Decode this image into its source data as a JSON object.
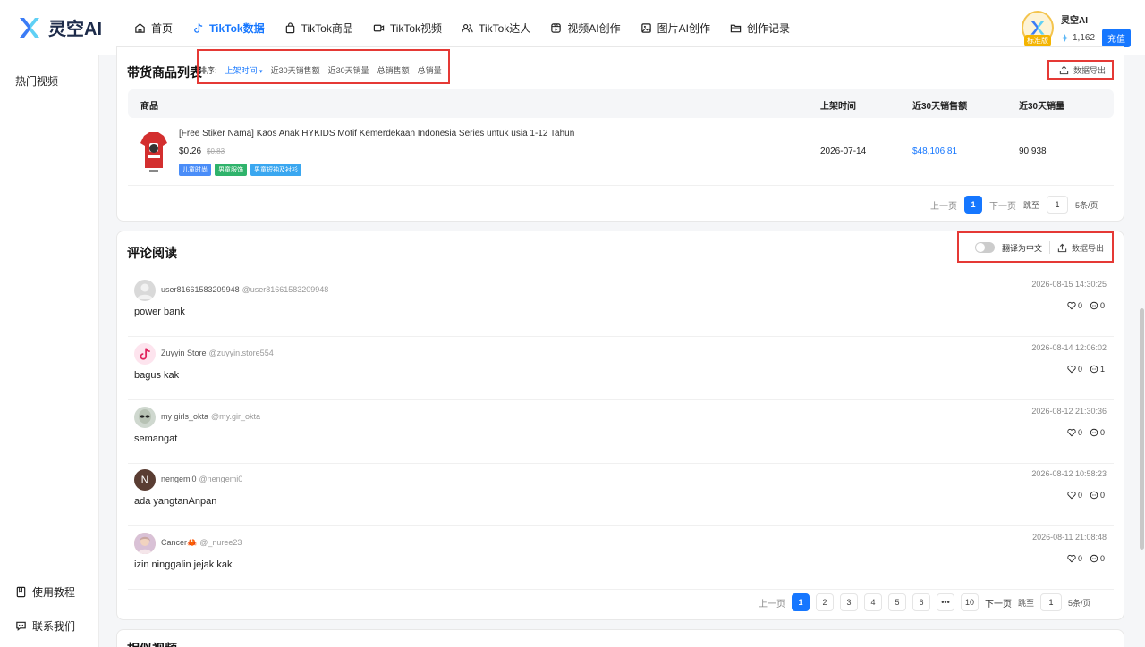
{
  "header": {
    "logo_text": "灵空AI",
    "nav": [
      {
        "label": "首页",
        "icon": "home-icon",
        "active": false
      },
      {
        "label": "TikTok数据",
        "icon": "tiktok-icon",
        "active": true
      },
      {
        "label": "TikTok商品",
        "icon": "bag-icon",
        "active": false
      },
      {
        "label": "TikTok视频",
        "icon": "video-icon",
        "active": false
      },
      {
        "label": "TikTok达人",
        "icon": "users-icon",
        "active": false
      },
      {
        "label": "视频AI创作",
        "icon": "film-icon",
        "active": false
      },
      {
        "label": "图片AI创作",
        "icon": "image-icon",
        "active": false
      },
      {
        "label": "创作记录",
        "icon": "folder-icon",
        "active": false
      }
    ],
    "user": {
      "name": "灵空AI",
      "badge": "标准版",
      "points": "1,162",
      "recharge": "充值"
    }
  },
  "sidebar": {
    "top_item": "热门视频",
    "bottom_items": [
      {
        "label": "使用教程",
        "icon": "book-icon"
      },
      {
        "label": "联系我们",
        "icon": "chat-icon"
      }
    ]
  },
  "products_card": {
    "title": "带货商品列表",
    "sort_label": "排序:",
    "sort_options": [
      "上架时间",
      "近30天销售额",
      "近30天销量",
      "总销售额",
      "总销量"
    ],
    "export_label": "数据导出",
    "columns": [
      "商品",
      "上架时间",
      "近30天销售额",
      "近30天销量"
    ],
    "rows": [
      {
        "name": "[Free Stiker Nama] Kaos Anak HYKIDS Motif Kemerdekaan Indonesia Series untuk usia 1-12 Tahun",
        "price": "$0.26",
        "old_price": "$0.83",
        "tags": [
          "儿童时尚",
          "男童服饰",
          "男童短袖及衬衫"
        ],
        "listed": "2026-07-14",
        "sales_30d": "$48,106.81",
        "volume_30d": "90,938"
      }
    ],
    "pager": {
      "prev": "上一页",
      "next": "下一页",
      "current": "1",
      "jump_label": "跳至",
      "jump_value": "1",
      "page_size": "5条/页"
    }
  },
  "comments_card": {
    "title": "评论阅读",
    "translate_label": "翻译为中文",
    "export_label": "数据导出",
    "comments": [
      {
        "user": "user81661583209948",
        "handle": "@user81661583209948",
        "text": "power bank",
        "time": "2026-08-15 14:30:25",
        "likes": "0",
        "replies": "0"
      },
      {
        "user": "Zuyyin Store",
        "handle": "@zuyyin.store554",
        "text": "bagus kak",
        "time": "2026-08-14 12:06:02",
        "likes": "0",
        "replies": "1"
      },
      {
        "user": "my girls_okta",
        "handle": "@my.gir_okta",
        "text": "semangat",
        "time": "2026-08-12 21:30:36",
        "likes": "0",
        "replies": "0"
      },
      {
        "user": "nengemi0",
        "handle": "@nengemi0",
        "text": "ada yangtanAnpan",
        "time": "2026-08-12 10:58:23",
        "likes": "0",
        "replies": "0",
        "initial": "N"
      },
      {
        "user": "Cancer🦀",
        "handle": "@_nuree23",
        "text": "izin ninggalin jejak kak",
        "time": "2026-08-11 21:08:48",
        "likes": "0",
        "replies": "0"
      }
    ],
    "pager": {
      "prev": "上一页",
      "next": "下一页",
      "pages": [
        "1",
        "2",
        "3",
        "4",
        "5",
        "6",
        "•••",
        "10"
      ],
      "current": "1",
      "jump_label": "跳至",
      "jump_value": "1",
      "page_size": "5条/页"
    }
  },
  "next_card": {
    "title": "相似视频"
  },
  "colors": {
    "accent": "#1677ff",
    "highlight_box": "#e53935",
    "tag_blue": "#4a8df8",
    "tag_green": "#2fb36b",
    "tag_sky": "#3aa7f0"
  }
}
